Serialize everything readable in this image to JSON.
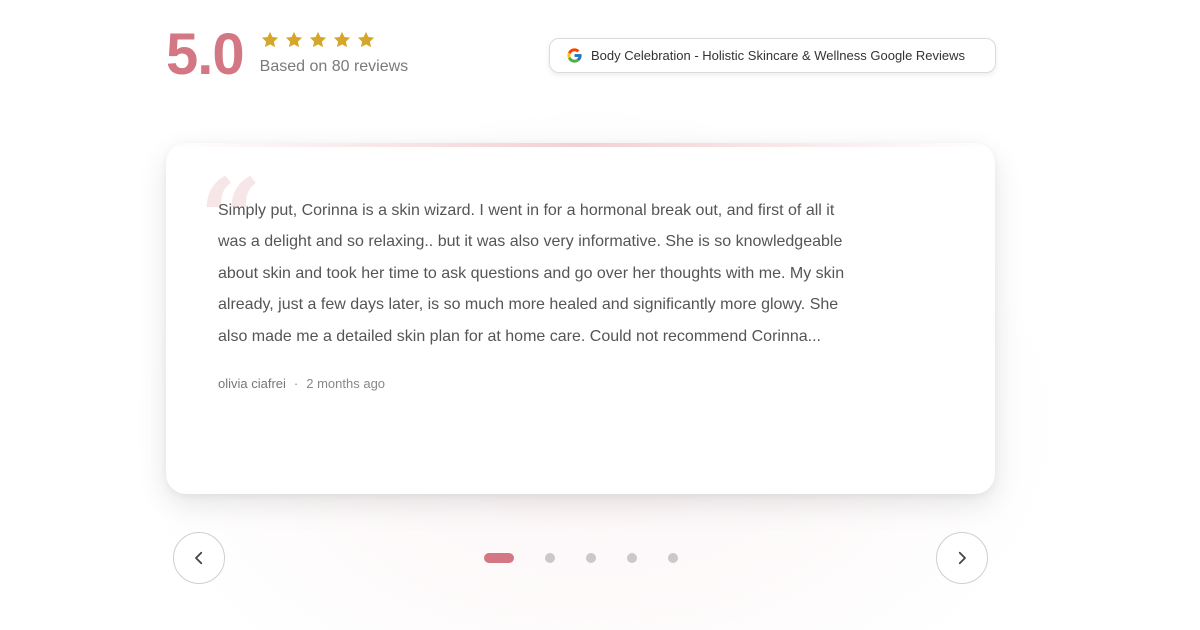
{
  "rating": {
    "score": "5.0",
    "stars": 5,
    "based_on": "Based on 80 reviews",
    "star_color": "#d4a62a",
    "accent_color": "#d27783"
  },
  "google_badge": {
    "icon": "google-g-icon",
    "label": "Body Celebration - Holistic Skincare & Wellness Google Reviews"
  },
  "review": {
    "quote_icon": "quote-icon",
    "text": "Simply put, Corinna is a skin wizard. I went in for a hormonal break out, and first of all it was a delight and so relaxing.. but it was also very informative. She is so knowledgeable about skin and took her time to ask questions and go over her thoughts with me. My skin already, just a few days later, is so much more healed and significantly more glowy. She also made me a detailed skin plan for at home care. Could not recommend Corinna...",
    "author": "olivia ciafrei",
    "separator": "·",
    "time_ago": "2 months ago"
  },
  "carousel": {
    "prev_icon": "chevron-left-icon",
    "next_icon": "chevron-right-icon",
    "page_count": 5,
    "active_index": 0
  }
}
